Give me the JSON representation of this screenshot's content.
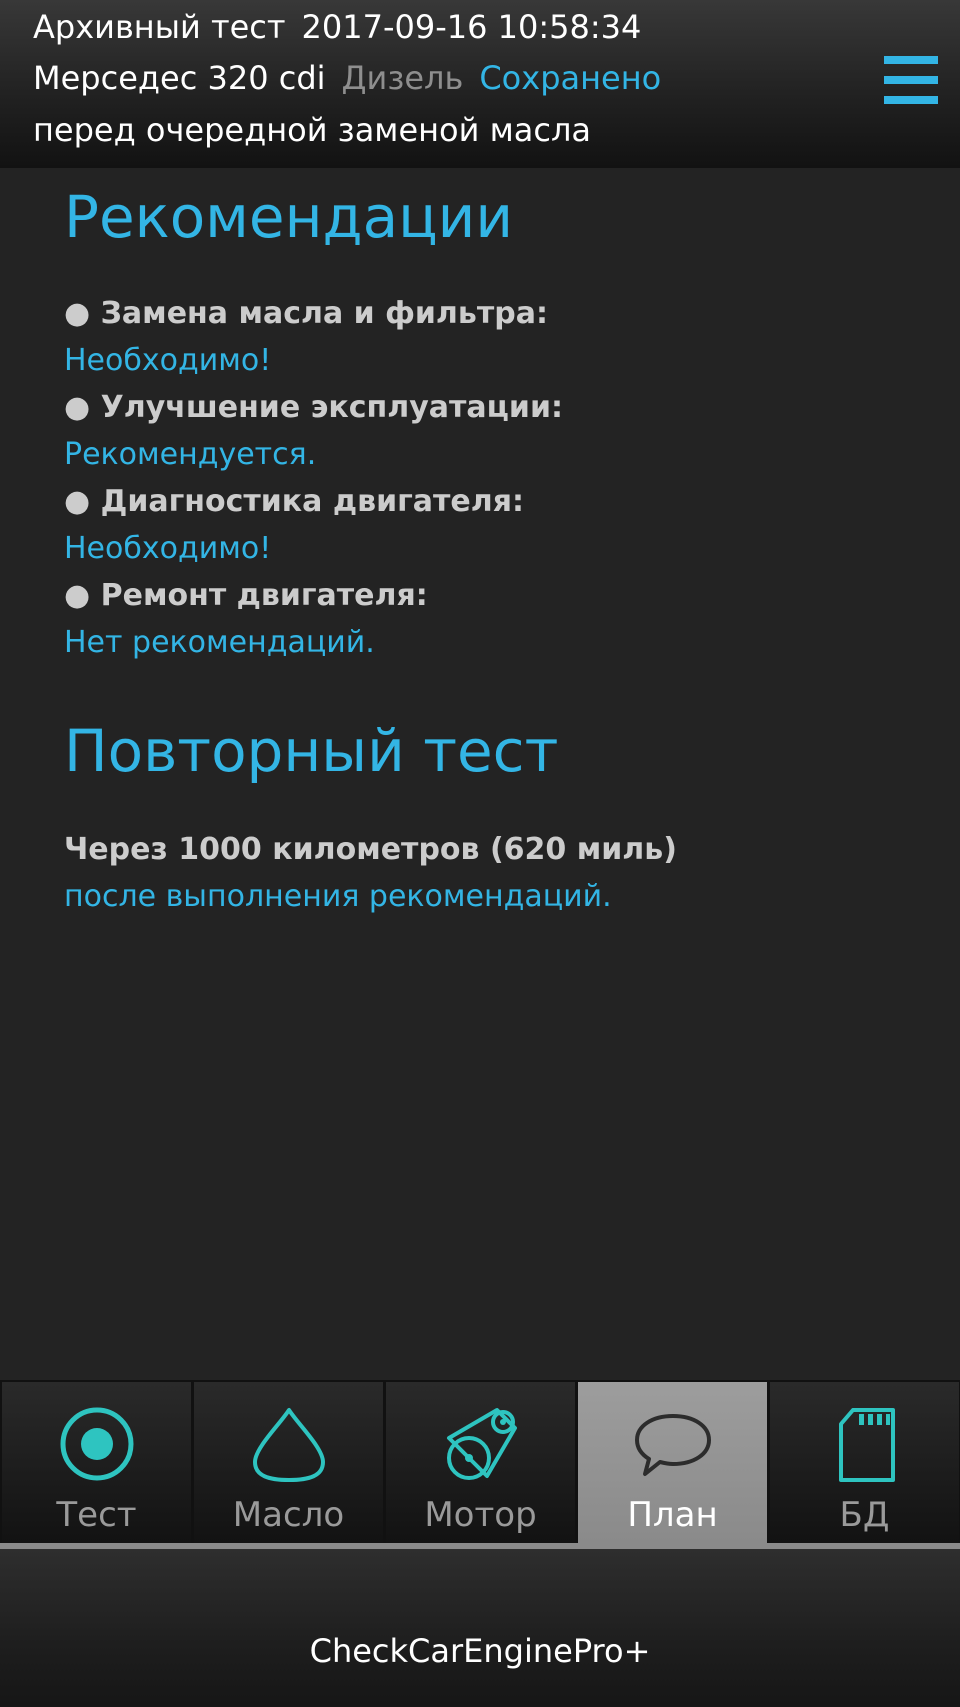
{
  "header": {
    "archive_label": "Архивный тест",
    "datetime": "2017-09-16 10:58:34",
    "car": "Мерседес 320 cdi",
    "fuel": "Дизель",
    "saved": "Сохранено",
    "note": "перед очередной заменой масла",
    "menu_icon": "hamburger-menu-icon"
  },
  "recommendations": {
    "title": "Рекомендации",
    "items": [
      {
        "label": "● Замена масла и фильтра:",
        "value": "Необходимо!"
      },
      {
        "label": "● Улучшение эксплуатации:",
        "value": "Рекомендуется."
      },
      {
        "label": "● Диагностика двигателя:",
        "value": "Необходимо!"
      },
      {
        "label": "● Ремонт двигателя:",
        "value": "Нет рекомендаций."
      }
    ]
  },
  "retest": {
    "title": "Повторный тест",
    "condition": "Через 1000 километров (620 миль)",
    "note": "после выполнения рекомендаций."
  },
  "tabs": [
    {
      "label": "Тест",
      "icon": "record-target-icon",
      "active": false
    },
    {
      "label": "Масло",
      "icon": "oil-drop-icon",
      "active": false
    },
    {
      "label": "Мотор",
      "icon": "engine-belt-icon",
      "active": false
    },
    {
      "label": "План",
      "icon": "speech-bubble-icon",
      "active": true
    },
    {
      "label": "БД",
      "icon": "sd-card-icon",
      "active": false
    }
  ],
  "colors": {
    "accent": "#33b5e5",
    "icon": "#2ec4c0",
    "background": "#232323"
  },
  "footer": {
    "app_name": "CheckCarEnginePro+"
  }
}
